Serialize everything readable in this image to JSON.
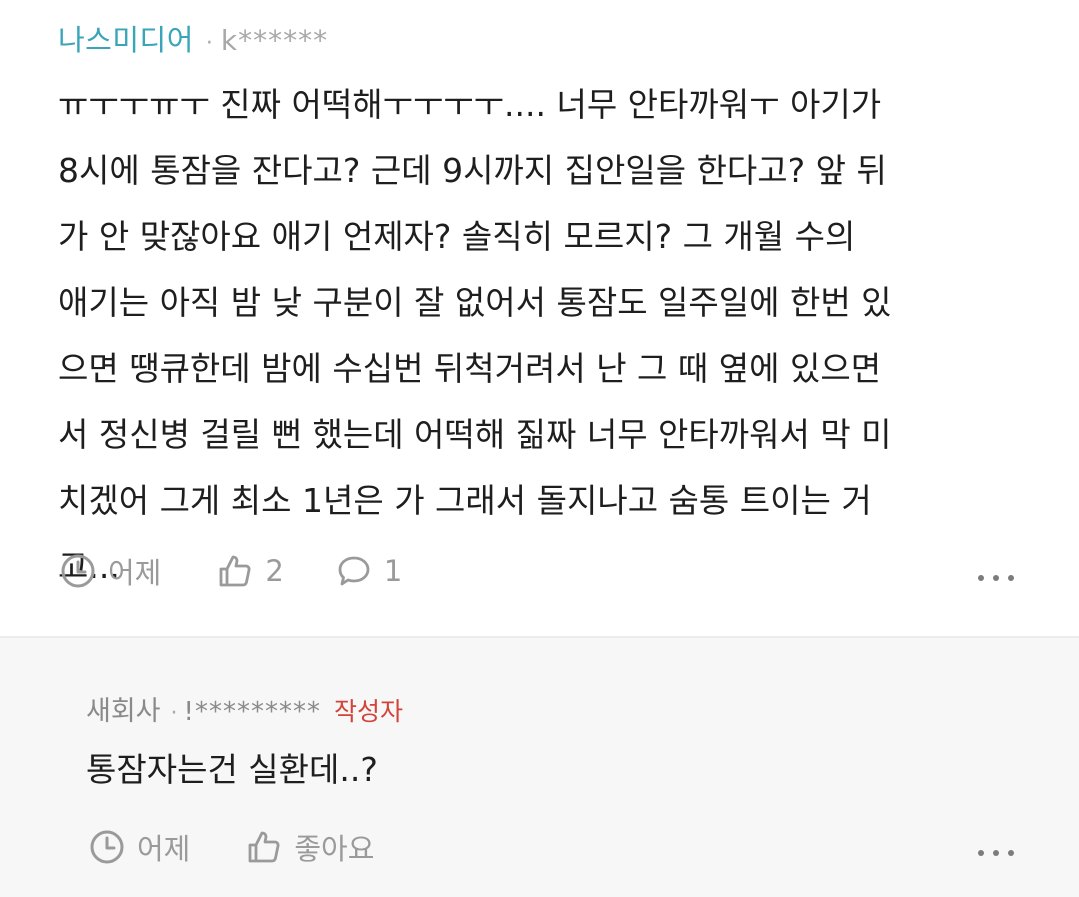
{
  "comment": {
    "nickname": "나스미디어",
    "separator": "·",
    "user_id": "k******",
    "body_lines": [
      "ㅠㅜㅜㅠㅜ 진짜 어떡해ㅜㅜㅜㅜ.... 너무 안타까워ㅜ 아기가",
      "8시에 통잠을 잔다고? 근데 9시까지 집안일을 한다고? 앞 뒤",
      "가 안 맞잖아요 애기 언제자? 솔직히 모르지? 그 개월 수의",
      "애기는 아직 밤 낮 구분이 잘 없어서 통잠도 일주일에 한번 있",
      "으면 땡큐한데 밤에 수십번 뒤척거려서 난 그 때 옆에 있으면",
      "서 정신병 걸릴 뻔 했는데 어떡해 짊짜 너무 안타까워서 막 미",
      "치겠어 그게 최소 1년은 가 그래서 돌지나고 숨통 트이는 거",
      "고..."
    ],
    "time": "어제",
    "like_count": "2",
    "reply_count": "1",
    "icons": [
      "clock-icon",
      "thumbs-up-icon",
      "speech-bubble-icon",
      "more-icon"
    ]
  },
  "reply": {
    "nickname": "새회사",
    "separator": "·",
    "user_id": "!*********",
    "author_badge": "작성자",
    "body": "통잠자는건 실환데..?",
    "time": "어제",
    "like_label": "좋아요",
    "icons": [
      "clock-icon",
      "thumbs-up-icon",
      "more-icon"
    ]
  },
  "colors": {
    "nickname": "#3aa5b9",
    "author_badge": "#d2443a",
    "meta_gray": "#9a9a9a",
    "body_text": "#1e1e1e",
    "reply_background": "#f7f7f7"
  }
}
